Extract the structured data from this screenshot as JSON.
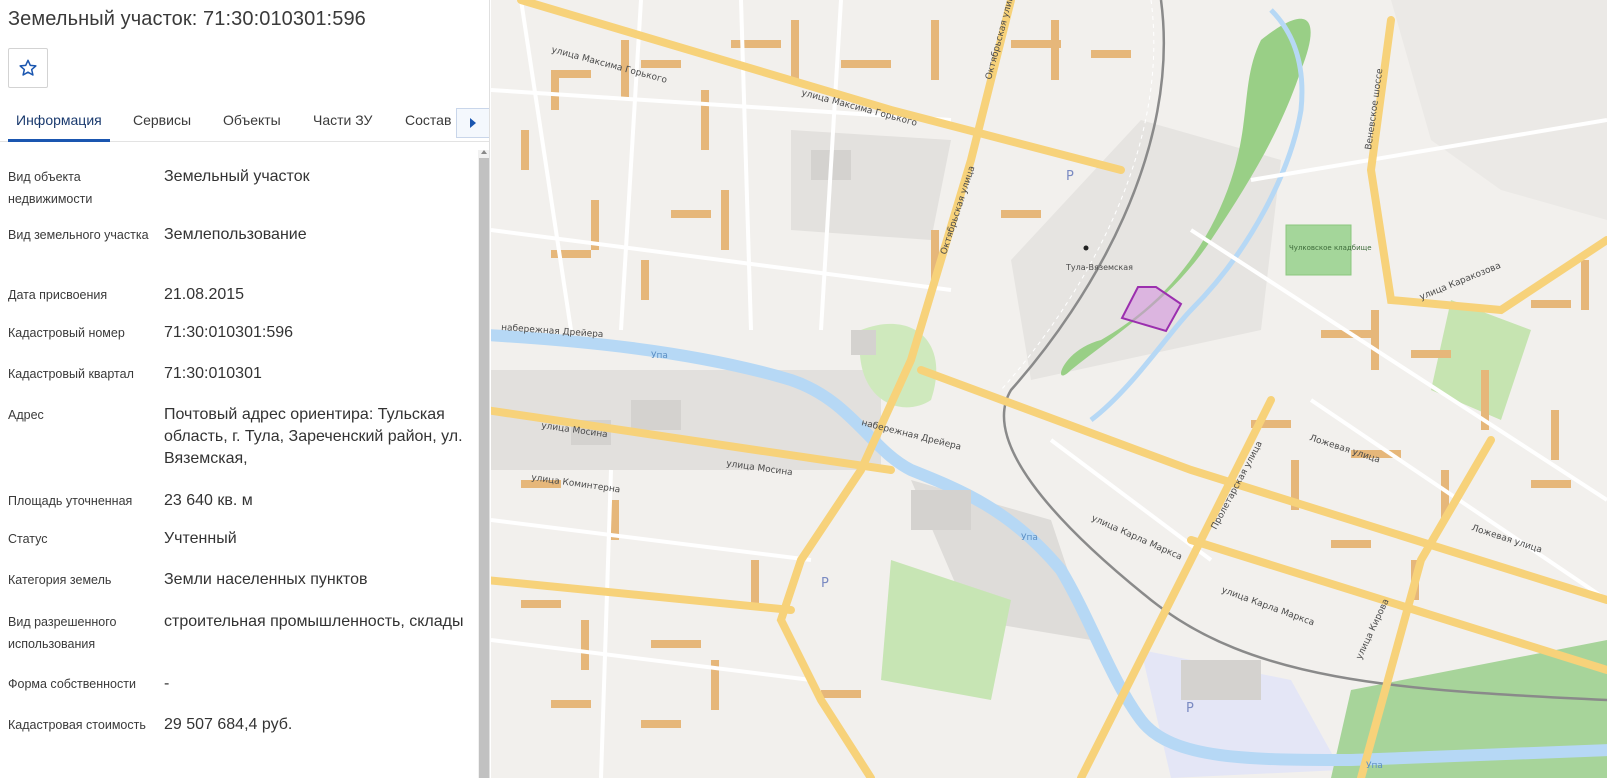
{
  "panel": {
    "title": "Земельный участок: 71:30:010301:596",
    "favorite_icon": "star-outline-icon",
    "tabs": [
      {
        "label": "Информация",
        "active": true
      },
      {
        "label": "Сервисы",
        "active": false
      },
      {
        "label": "Объекты",
        "active": false
      },
      {
        "label": "Части ЗУ",
        "active": false
      },
      {
        "label": "Состав",
        "active": false
      }
    ],
    "tabs_next_icon": "caret-right-icon",
    "fields": [
      {
        "label": "Вид объекта недвижимости",
        "value": "Земельный участок"
      },
      {
        "label": "Вид земельного участка",
        "value": "Землепользование"
      },
      {
        "label": "Дата присвоения",
        "value": "21.08.2015"
      },
      {
        "label": "Кадастровый номер",
        "value": "71:30:010301:596"
      },
      {
        "label": "Кадастровый квартал",
        "value": "71:30:010301"
      },
      {
        "label": "Адрес",
        "value": "Почтовый адрес ориентира: Тульская область, г. Тула, Зареченский район, ул. Вяземская,"
      },
      {
        "label": "Площадь уточненная",
        "value": "23 640 кв. м"
      },
      {
        "label": "Статус",
        "value": "Учтенный"
      },
      {
        "label": "Категория земель",
        "value": "Земли населенных пунктов"
      },
      {
        "label": "Вид разрешенного использования",
        "value": "строительная промышленность, склады"
      },
      {
        "label": "Форма собственности",
        "value": "-"
      },
      {
        "label": "Кадастровая стоимость",
        "value": "29 507 684,4 руб."
      }
    ]
  },
  "map": {
    "colors": {
      "major_road": "#f7d27a",
      "water": "#b6d8f5",
      "park": "#9fd08a",
      "building": "#e6b77a",
      "parcel": "#9b2fae"
    },
    "labels": {
      "street_maxim_gorky": "улица Максима Горького",
      "street_mosina": "улица Мосина",
      "street_oktyabrskaya": "Октябрьская улица",
      "street_lozhevaya": "Ложевая улица",
      "street_karla_marksa": "улица Карла Маркса",
      "street_kirova": "улица Кирова",
      "street_karakozova": "улица Каракозова",
      "street_proletarskaya": "Пролетарская улица",
      "street_kommunterna": "улица Коминтерна",
      "street_veneevskoe": "Веневское шоссе",
      "river_upa": "Упа",
      "station_name": "Тула-Вяземская",
      "cemetery": "Чулковское кладбище",
      "embankment": "набережная Дрейера",
      "parking_sign": "P"
    }
  }
}
